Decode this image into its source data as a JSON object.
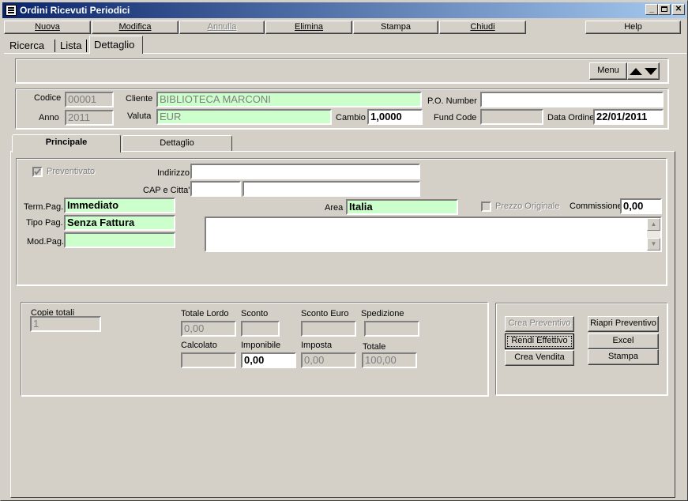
{
  "window": {
    "title": "Ordini Ricevuti Periodici"
  },
  "menu": {
    "nuova": "Nuova",
    "modifica": "Modifica",
    "annulla": "Annulla",
    "elimina": "Elimina",
    "stampa": "Stampa",
    "chiudi": "Chiudi",
    "help": "Help"
  },
  "top_tabs": [
    "Ricerca",
    "Lista",
    "Dettaglio"
  ],
  "toolbar": {
    "menu_label": "Menu"
  },
  "header": {
    "codice_label": "Codice",
    "codice": "00001",
    "anno_label": "Anno",
    "anno": "2011",
    "cliente_label": "Cliente",
    "cliente": "BIBLIOTECA MARCONI",
    "valuta_label": "Valuta",
    "valuta": "EUR",
    "cambio_label": "Cambio",
    "cambio": "1,0000",
    "po_label": "P.O. Number",
    "po": "",
    "fund_label": "Fund Code",
    "fund": "",
    "data_ordine_label": "Data Ordine",
    "data_ordine": "22/01/2011"
  },
  "inner_tabs": [
    "Principale",
    "Dettaglio"
  ],
  "principale": {
    "preventivato_label": "Preventivato",
    "indirizzo_label": "Indirizzo",
    "indirizzo": "",
    "cap_label": "CAP e Citta'",
    "cap": "",
    "citta": "",
    "term_label": "Term.Pag.",
    "term": "Immediato",
    "tipo_label": "Tipo Pag.",
    "tipo": "Senza Fattura",
    "mod_label": "Mod.Pag.",
    "mod": "",
    "area_label": "Area",
    "area": "Italia",
    "prezzo_label": "Prezzo Originale",
    "commissione_label": "Commissione",
    "commissione": "0,00",
    "note": ""
  },
  "totals": {
    "copie_label": "Copie totali",
    "copie": "1",
    "lordo_label": "Totale Lordo",
    "lordo": "0,00",
    "sconto_label": "Sconto",
    "sconto": "",
    "sconto_euro_label": "Sconto Euro",
    "sconto_euro": "",
    "spedizione_label": "Spedizione",
    "spedizione": "",
    "calcolato_label": "Calcolato",
    "calcolato": "",
    "imponibile_label": "Imponibile",
    "imponibile": "0,00",
    "imposta_label": "Imposta",
    "imposta": "0,00",
    "totale_label": "Totale",
    "totale": "100,00"
  },
  "actions": {
    "crea_preventivo": "Crea Preventivo",
    "rendi_effettivo": "Rendi Effettivo",
    "crea_vendita": "Crea Vendita",
    "riapri_preventivo": "Riapri Preventivo",
    "excel": "Excel",
    "stampa": "Stampa"
  }
}
